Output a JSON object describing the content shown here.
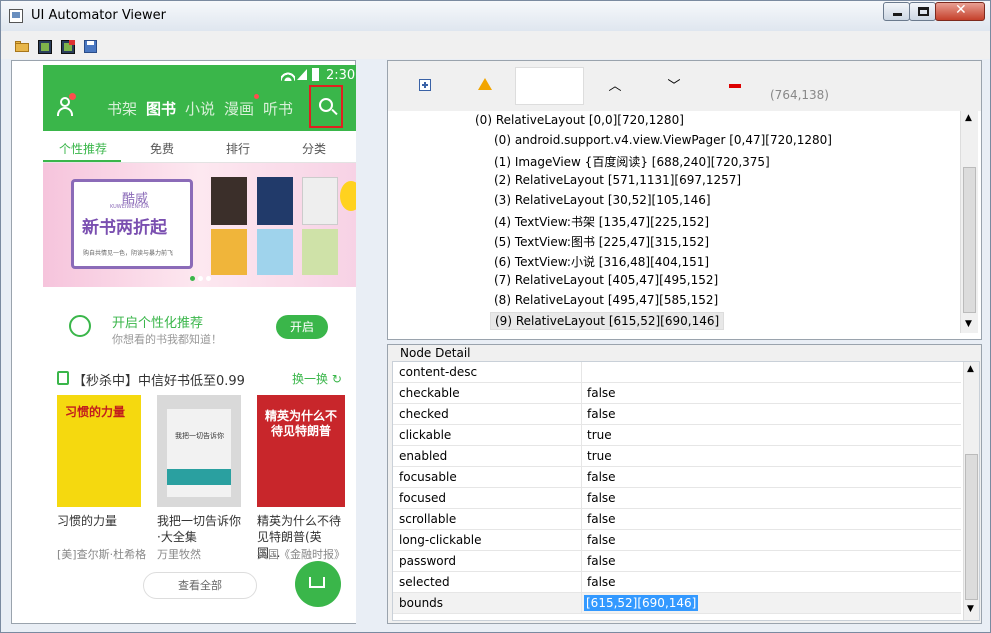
{
  "window": {
    "title": "UI Automator Viewer",
    "controls": {
      "minimize": "minimize-button",
      "maximize": "maximize-button",
      "close": "close-button"
    }
  },
  "toolbar": {
    "icons": [
      "open-folder-icon",
      "device-screenshot-icon",
      "device-screenshot-compressed-icon",
      "save-icon"
    ]
  },
  "phone": {
    "status_time": "2:30",
    "header_tabs": [
      "书架",
      "图书",
      "小说",
      "漫画",
      "听书"
    ],
    "active_header_tab": "图书",
    "sub_tabs": [
      "个性推荐",
      "免费",
      "排行",
      "分类"
    ],
    "banner": {
      "brand": "酷威",
      "brand_en": "KUWEIWENHUA",
      "headline": "新书两折起",
      "tagline": "购自共情见一色，阴读与暴力前飞"
    },
    "promo": {
      "title": "开启个性化推荐",
      "subtitle": "你想看的书我都知道！",
      "button": "开启"
    },
    "section": {
      "title": "【秒杀中】中信好书低至0.99",
      "action": "换一换"
    },
    "books": [
      {
        "cover_title": "习惯的力量",
        "title": "习惯的力量",
        "author": "[美]查尔斯·杜希格",
        "color": "#f5d90f"
      },
      {
        "cover_title": "我把一切告诉你",
        "title": "我把一切告诉你·大全集",
        "author": "万里牧然",
        "color": "#d9d9d9"
      },
      {
        "cover_title": "精英为什么不待见特朗普",
        "title": "精英为什么不待见特朗普(英国...",
        "author": "英国《金融时报》",
        "color": "#c8262b"
      }
    ],
    "view_all": "查看全部"
  },
  "right_toolbar": {
    "coords": "(764,138)"
  },
  "tree": {
    "nodes": [
      "(0) RelativeLayout [0,0][720,1280]",
      "(0) android.support.v4.view.ViewPager [0,47][720,1280]",
      "(1) ImageView {百度阅读} [688,240][720,375]",
      "(2) RelativeLayout [571,1131][697,1257]",
      "(3) RelativeLayout [30,52][105,146]",
      "(4) TextView:书架 [135,47][225,152]",
      "(5) TextView:图书 [225,47][315,152]",
      "(6) TextView:小说 [316,48][404,151]",
      "(7) RelativeLayout [405,47][495,152]",
      "(8) RelativeLayout [495,47][585,152]",
      "(9) RelativeLayout [615,52][690,146]"
    ]
  },
  "node_detail": {
    "label": "Node Detail",
    "rows": [
      {
        "key": "content-desc",
        "value": ""
      },
      {
        "key": "checkable",
        "value": "false"
      },
      {
        "key": "checked",
        "value": "false"
      },
      {
        "key": "clickable",
        "value": "true"
      },
      {
        "key": "enabled",
        "value": "true"
      },
      {
        "key": "focusable",
        "value": "false"
      },
      {
        "key": "focused",
        "value": "false"
      },
      {
        "key": "scrollable",
        "value": "false"
      },
      {
        "key": "long-clickable",
        "value": "false"
      },
      {
        "key": "password",
        "value": "false"
      },
      {
        "key": "selected",
        "value": "false"
      },
      {
        "key": "bounds",
        "value": "[615,52][690,146]"
      }
    ]
  }
}
